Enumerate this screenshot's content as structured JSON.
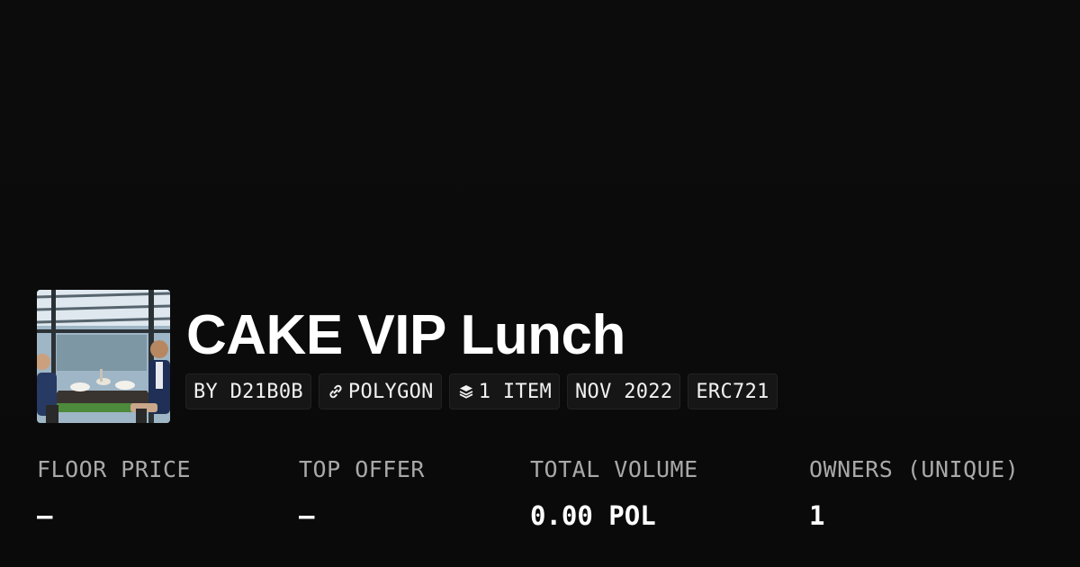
{
  "collection": {
    "title": "CAKE VIP Lunch",
    "thumbnail_alt": "photo of two people at a restaurant table"
  },
  "chips": [
    {
      "label": "BY D21B0B",
      "icon": ""
    },
    {
      "label": "POLYGON",
      "icon": "chain-link-icon"
    },
    {
      "label": "1 ITEM",
      "icon": "layers-icon"
    },
    {
      "label": "NOV 2022",
      "icon": ""
    },
    {
      "label": "ERC721",
      "icon": ""
    }
  ],
  "stats": [
    {
      "label": "FLOOR PRICE",
      "value": "–"
    },
    {
      "label": "TOP OFFER",
      "value": "–"
    },
    {
      "label": "TOTAL VOLUME",
      "value": "0.00 POL"
    },
    {
      "label": "OWNERS (UNIQUE)",
      "value": "1"
    }
  ],
  "colors": {
    "background": "#0b0b0b",
    "chip_bg": "#161616",
    "text": "#ffffff",
    "muted": "#a9a9a9"
  }
}
